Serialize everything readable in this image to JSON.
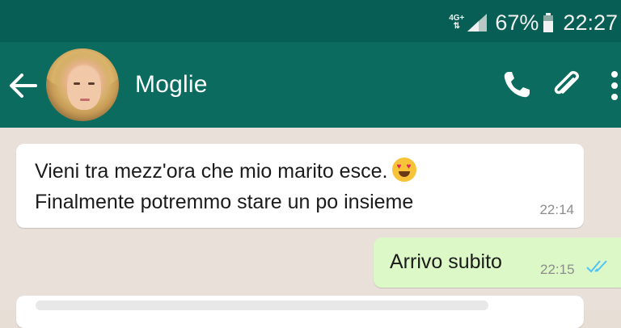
{
  "status_bar": {
    "network_type": "4G+",
    "network_arrows": "⇅",
    "battery_percent": "67%",
    "clock": "22:27",
    "signal_icon": "cell-signal-icon",
    "battery_icon": "battery-icon"
  },
  "app_bar": {
    "contact_name": "Moglie",
    "back_icon": "back-arrow-icon",
    "avatar": "contact-avatar",
    "call_icon": "phone-icon",
    "attach_icon": "paperclip-icon",
    "menu_icon": "more-vertical-icon",
    "color": "#0b6b5f"
  },
  "messages": [
    {
      "direction": "incoming",
      "lines": [
        "Vieni tra mezz'ora che mio marito esce.",
        "Finalmente potremmo stare un po insieme"
      ],
      "emoji": "heart-eyes-emoji",
      "time": "22:14"
    },
    {
      "direction": "outgoing",
      "text": "Arrivo subito",
      "time": "22:15",
      "status_icon": "double-check-icon",
      "status_color": "#4fc3f7"
    }
  ],
  "colors": {
    "status_bar": "#075e54",
    "chat_background": "#e9e1d9",
    "outgoing_bubble": "#dcf8c6",
    "incoming_bubble": "#ffffff"
  }
}
